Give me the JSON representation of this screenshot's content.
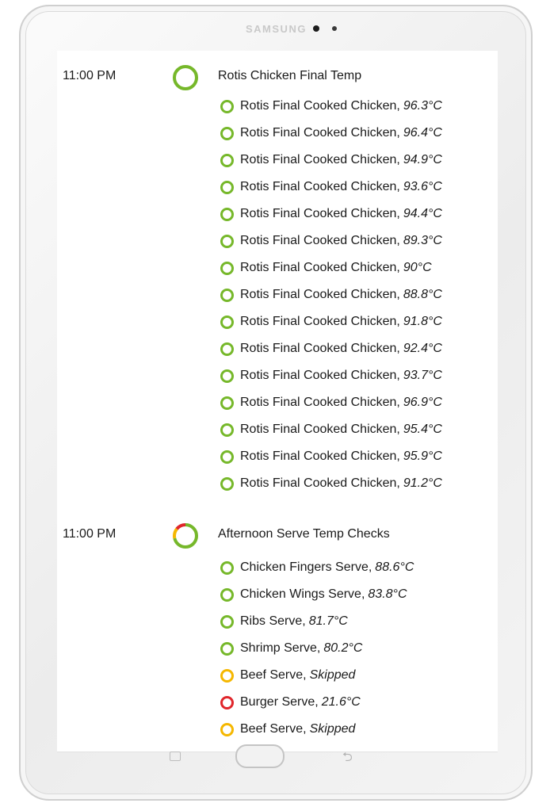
{
  "device": {
    "brand": "SAMSUNG"
  },
  "colors": {
    "pass": "#76b82a",
    "warning": "#f5b700",
    "fail": "#e0262b",
    "ring_track": "#e3e3e3"
  },
  "groups": [
    {
      "time": "11:00 PM",
      "title": "Rotis Chicken Final Temp",
      "ring": [
        {
          "status": "pass",
          "fraction": 1.0
        }
      ],
      "items": [
        {
          "name": "Rotis Final Cooked Chicken",
          "value": "96.3°C",
          "status": "pass"
        },
        {
          "name": "Rotis Final Cooked Chicken",
          "value": "96.4°C",
          "status": "pass"
        },
        {
          "name": "Rotis Final Cooked Chicken",
          "value": "94.9°C",
          "status": "pass"
        },
        {
          "name": "Rotis Final Cooked Chicken",
          "value": "93.6°C",
          "status": "pass"
        },
        {
          "name": "Rotis Final Cooked Chicken",
          "value": "94.4°C",
          "status": "pass"
        },
        {
          "name": "Rotis Final Cooked Chicken",
          "value": "89.3°C",
          "status": "pass"
        },
        {
          "name": "Rotis Final Cooked Chicken",
          "value": "90°C",
          "status": "pass"
        },
        {
          "name": "Rotis Final Cooked Chicken",
          "value": "88.8°C",
          "status": "pass"
        },
        {
          "name": "Rotis Final Cooked Chicken",
          "value": "91.8°C",
          "status": "pass"
        },
        {
          "name": "Rotis Final Cooked Chicken",
          "value": "92.4°C",
          "status": "pass"
        },
        {
          "name": "Rotis Final Cooked Chicken",
          "value": "93.7°C",
          "status": "pass"
        },
        {
          "name": "Rotis Final Cooked Chicken",
          "value": "96.9°C",
          "status": "pass"
        },
        {
          "name": "Rotis Final Cooked Chicken",
          "value": "95.4°C",
          "status": "pass"
        },
        {
          "name": "Rotis Final Cooked Chicken",
          "value": "95.9°C",
          "status": "pass"
        },
        {
          "name": "Rotis Final Cooked Chicken",
          "value": "91.2°C",
          "status": "pass"
        }
      ]
    },
    {
      "time": "11:00 PM",
      "title": "Afternoon Serve Temp Checks",
      "ring": [
        {
          "status": "pass",
          "fraction": 0.714
        },
        {
          "status": "warning",
          "fraction": 0.143
        },
        {
          "status": "fail",
          "fraction": 0.143
        }
      ],
      "items": [
        {
          "name": "Chicken Fingers Serve",
          "value": "88.6°C",
          "status": "pass"
        },
        {
          "name": "Chicken Wings Serve",
          "value": "83.8°C",
          "status": "pass"
        },
        {
          "name": "Ribs Serve",
          "value": "81.7°C",
          "status": "pass"
        },
        {
          "name": "Shrimp Serve",
          "value": "80.2°C",
          "status": "pass"
        },
        {
          "name": "Beef Serve",
          "value": "Skipped",
          "status": "warning"
        },
        {
          "name": "Burger Serve",
          "value": "21.6°C",
          "status": "fail"
        },
        {
          "name": "Beef Serve",
          "value": "Skipped",
          "status": "warning"
        }
      ]
    }
  ],
  "nav": {
    "recent_icon": "recent-apps-icon",
    "home_icon": "home-button",
    "back_icon": "back-icon"
  }
}
